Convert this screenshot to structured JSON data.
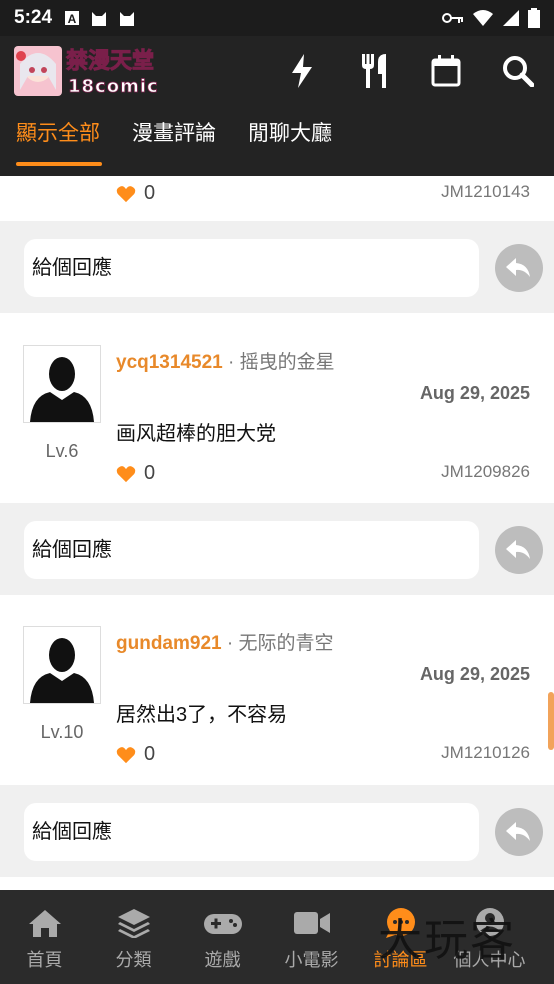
{
  "status_bar": {
    "time": "5:24"
  },
  "app": {
    "logo_text": "禁漫天堂",
    "logo_sub": "18comic"
  },
  "tabs": [
    {
      "label": "顯示全部",
      "active": true
    },
    {
      "label": "漫畫評論",
      "active": false
    },
    {
      "label": "閒聊大廳",
      "active": false
    }
  ],
  "partial_card": {
    "likes": "0",
    "jm": "JM1210143"
  },
  "reply_placeholder": "給個回應",
  "comments": [
    {
      "username": "ycq1314521",
      "title": "· 摇曳的金星",
      "date": "Aug 29, 2025",
      "text": "画风超棒的胆大党",
      "level": "Lv.6",
      "likes": "0",
      "jm": "JM1209826"
    },
    {
      "username": "gundam921",
      "title": "· 无际的青空",
      "date": "Aug 29, 2025",
      "text": "居然出3了，不容易",
      "level": "Lv.10",
      "likes": "0",
      "jm": "JM1210126"
    }
  ],
  "bottom_nav": [
    {
      "label": "首頁",
      "icon": "home-icon",
      "active": false
    },
    {
      "label": "分類",
      "icon": "layers-icon",
      "active": false
    },
    {
      "label": "遊戲",
      "icon": "gamepad-icon",
      "active": false
    },
    {
      "label": "小電影",
      "icon": "video-icon",
      "active": false
    },
    {
      "label": "討論區",
      "icon": "chat-icon",
      "active": true
    },
    {
      "label": "個人中心",
      "icon": "user-icon",
      "active": false
    }
  ],
  "watermark": "大玩客",
  "colors": {
    "accent": "#ff8d1a",
    "header_bg": "#232323",
    "bottom_bg": "#2b2b2b"
  }
}
